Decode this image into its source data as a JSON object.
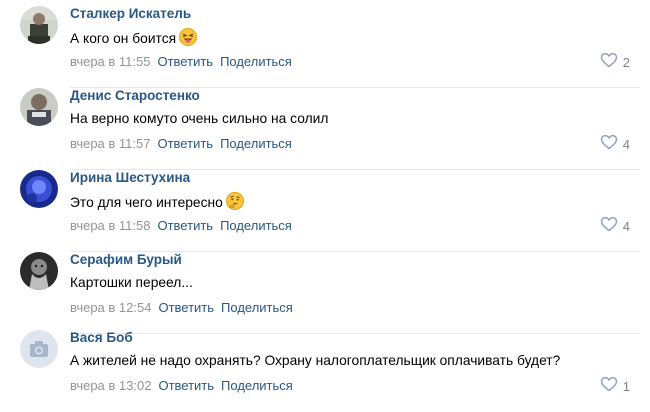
{
  "comments": [
    {
      "author": "Сталкер Искатель",
      "text": "А кого он боится",
      "emoji": "tongue-out-squint-emoji",
      "time": "вчера в 11:55",
      "reply": "Ответить",
      "share": "Поделиться",
      "likes": "2"
    },
    {
      "author": "Денис Старостенко",
      "text": "На верно комуто очень сильно на солил",
      "emoji": "",
      "time": "вчера в 11:57",
      "reply": "Ответить",
      "share": "Поделиться",
      "likes": "4"
    },
    {
      "author": "Ирина Шестухина",
      "text": "Это для чего интересно",
      "emoji": "thinking-face-emoji",
      "time": "вчера в 11:58",
      "reply": "Ответить",
      "share": "Поделиться",
      "likes": "4"
    },
    {
      "author": "Серафим Бурый",
      "text": "Картошки переел...",
      "emoji": "",
      "time": "вчера в 12:54",
      "reply": "Ответить",
      "share": "Поделиться",
      "likes": ""
    },
    {
      "author": "Вася Боб",
      "text": "А жителей не надо охранять? Охрану налогоплательщик оплачивать будет?",
      "emoji": "",
      "time": "вчера в 13:02",
      "reply": "Ответить",
      "share": "Поделиться",
      "likes": "1"
    }
  ],
  "colors": {
    "link": "#2a5885",
    "meta": "#939393",
    "like_icon": "#93a3bc"
  }
}
